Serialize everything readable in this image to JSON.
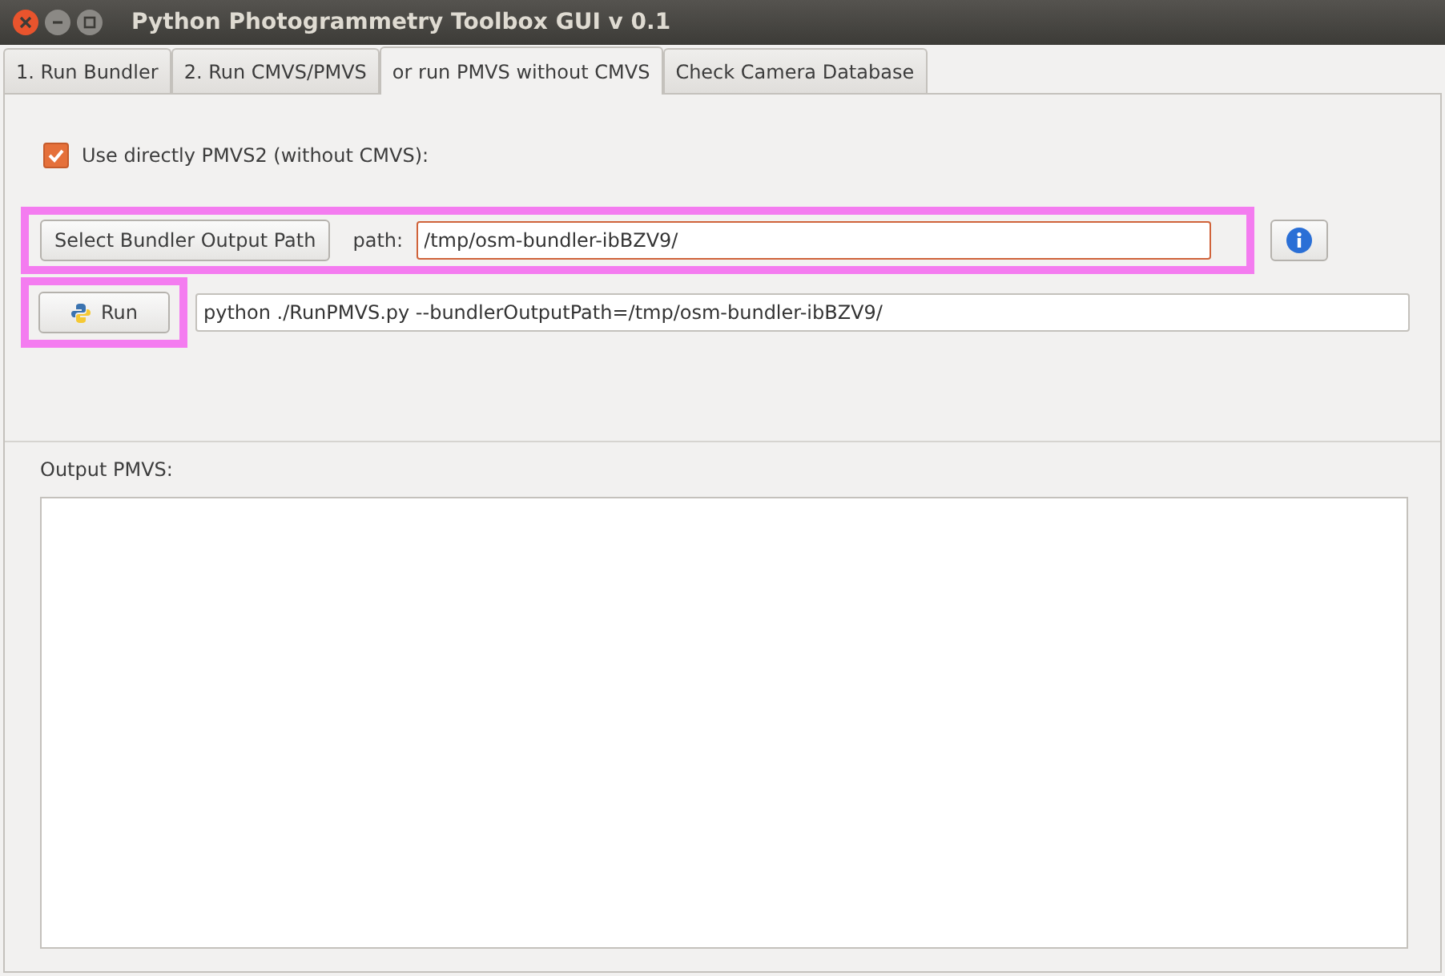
{
  "window": {
    "title": "Python Photogrammetry Toolbox GUI v 0.1"
  },
  "tabs": [
    {
      "label": "1. Run Bundler",
      "selected": false
    },
    {
      "label": "2. Run CMVS/PMVS",
      "selected": false
    },
    {
      "label": "or run PMVS without CMVS",
      "selected": true
    },
    {
      "label": "Check Camera Database",
      "selected": false
    }
  ],
  "option": {
    "label": "Use directly PMVS2 (without CMVS):",
    "checked": true
  },
  "path_row": {
    "button": "Select Bundler Output Path",
    "label": "path:",
    "value": "/tmp/osm-bundler-ibBZV9/",
    "highlighted": true
  },
  "run_row": {
    "button": "Run",
    "command": "python ./RunPMVS.py --bundlerOutputPath=/tmp/osm-bundler-ibBZV9/",
    "highlighted": true
  },
  "output": {
    "label": "Output PMVS:"
  }
}
